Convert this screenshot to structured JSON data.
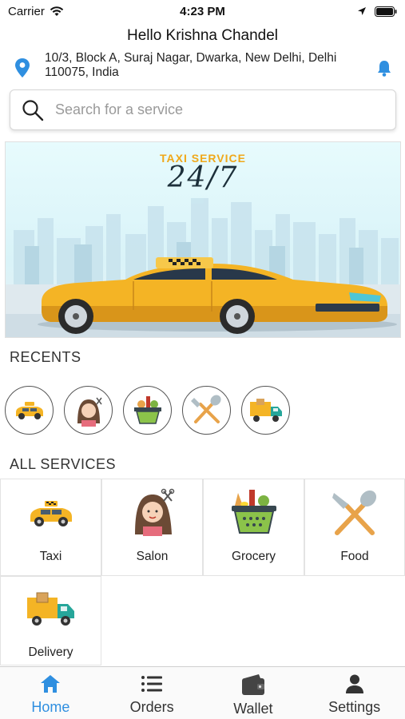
{
  "status_bar": {
    "carrier": "Carrier",
    "time": "4:23 PM"
  },
  "header": {
    "greeting": "Hello Krishna Chandel",
    "address": "10/3, Block A, Suraj Nagar, Dwarka, New Delhi, Delhi 110075, India"
  },
  "search": {
    "placeholder": "Search for a service",
    "value": ""
  },
  "banner": {
    "title": "TAXI SERVICE",
    "subtitle": "24/7"
  },
  "recents": {
    "title": "RECENTS",
    "items": [
      {
        "icon": "taxi-icon"
      },
      {
        "icon": "salon-icon"
      },
      {
        "icon": "grocery-icon"
      },
      {
        "icon": "food-icon"
      },
      {
        "icon": "delivery-icon"
      }
    ]
  },
  "all_services": {
    "title": "ALL SERVICES",
    "items": [
      {
        "label": "Taxi",
        "icon": "taxi-icon"
      },
      {
        "label": "Salon",
        "icon": "salon-icon"
      },
      {
        "label": "Grocery",
        "icon": "grocery-icon"
      },
      {
        "label": "Food",
        "icon": "food-icon"
      },
      {
        "label": "Delivery",
        "icon": "delivery-icon"
      }
    ]
  },
  "tabbar": {
    "items": [
      {
        "label": "Home",
        "icon": "home-icon",
        "active": true
      },
      {
        "label": "Orders",
        "icon": "list-icon",
        "active": false
      },
      {
        "label": "Wallet",
        "icon": "wallet-icon",
        "active": false
      },
      {
        "label": "Settings",
        "icon": "person-icon",
        "active": false
      }
    ]
  },
  "colors": {
    "accent": "#2f8fe0",
    "taxi_yellow": "#f4b425",
    "banner_bg": "#e7fbfd"
  }
}
